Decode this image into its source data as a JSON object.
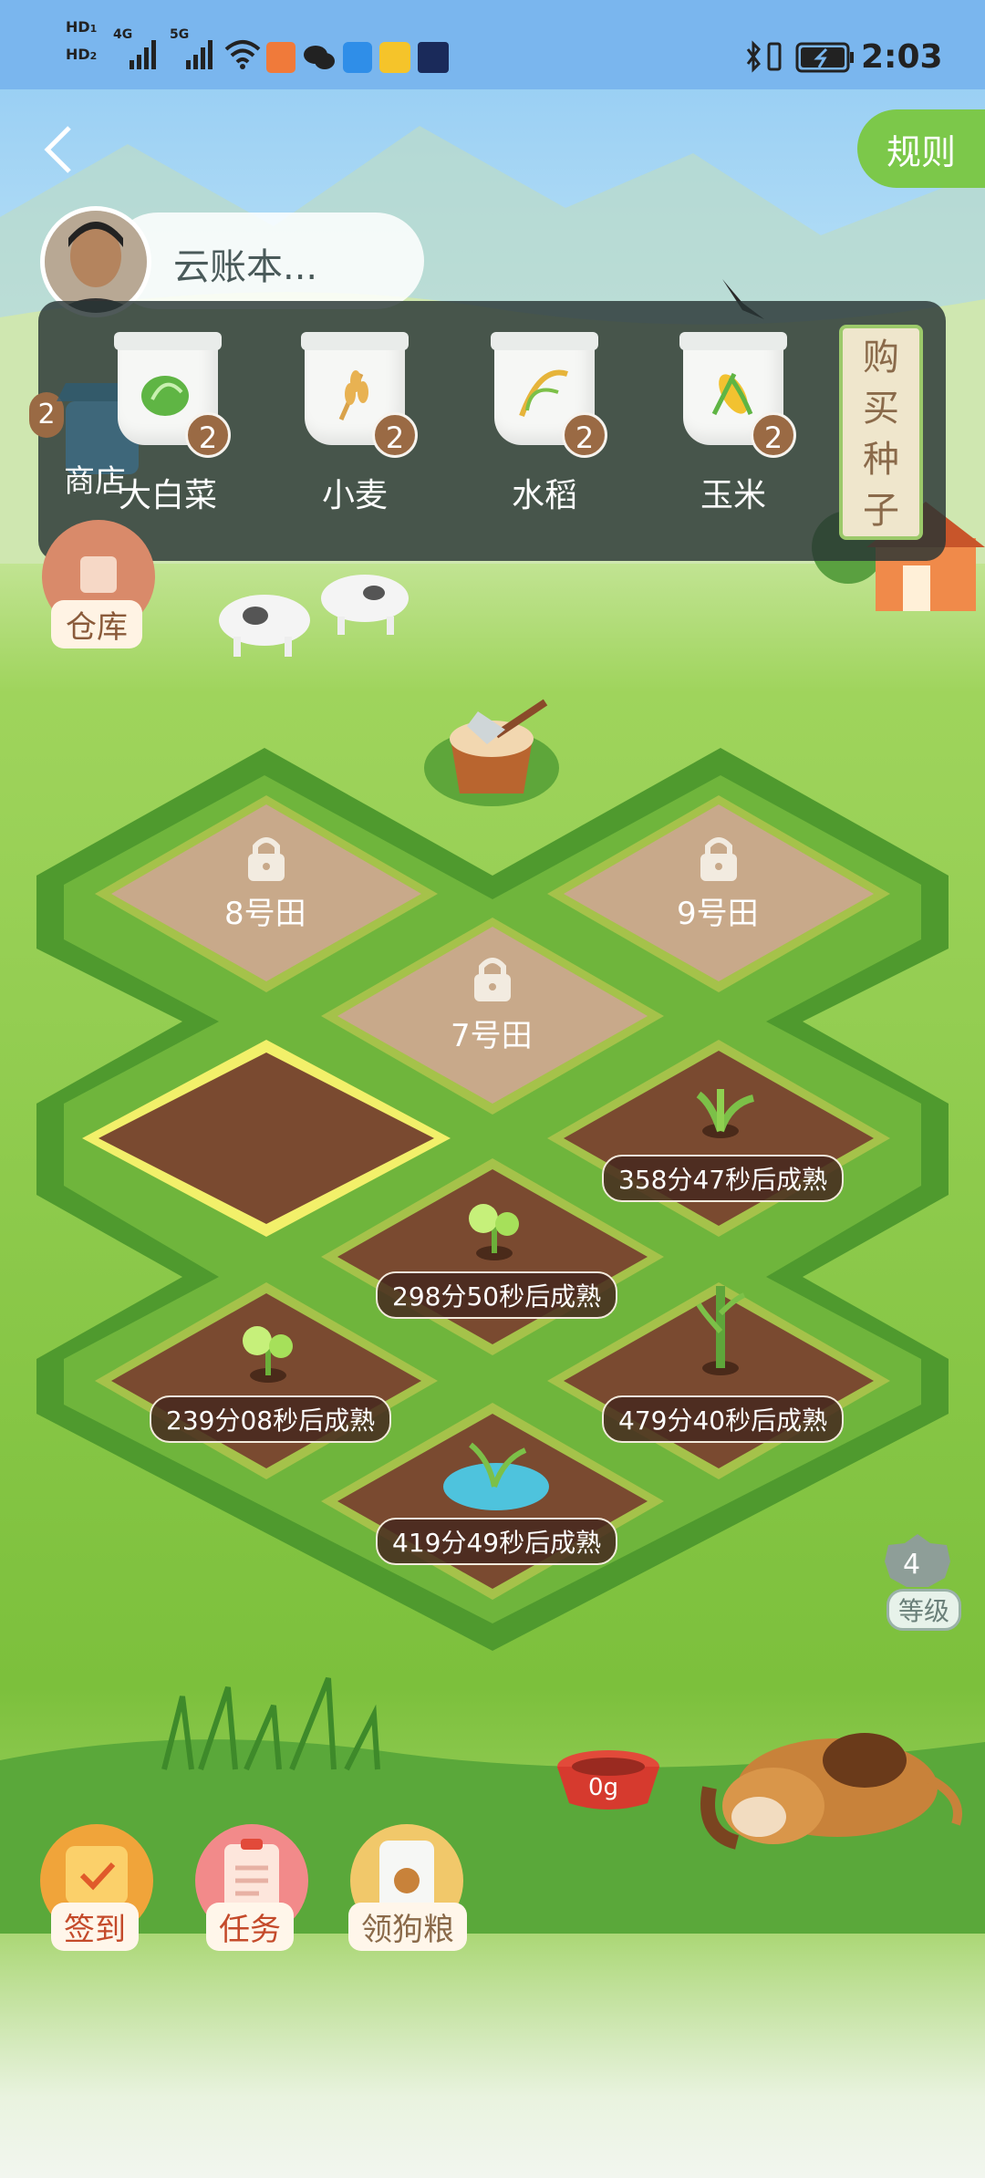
{
  "status_bar": {
    "hd1": "HD",
    "hd1_sub": "1",
    "hd2": "HD",
    "hd2_sub": "2",
    "net1": "4G",
    "net2": "5G",
    "time": "2:03"
  },
  "header": {
    "rules_label": "规则"
  },
  "account": {
    "name": "云账本..."
  },
  "seed_panel": {
    "items": [
      {
        "name": "大白菜",
        "count": "2"
      },
      {
        "name": "小麦",
        "count": "2"
      },
      {
        "name": "水稻",
        "count": "2"
      },
      {
        "name": "玉米",
        "count": "2"
      }
    ],
    "partial_count": "2",
    "buy_label": [
      "购",
      "买",
      "种",
      "子"
    ]
  },
  "side": {
    "shop_label": "商店",
    "warehouse_label": "仓库"
  },
  "fields": {
    "locked": [
      {
        "label": "8号田"
      },
      {
        "label": "9号田"
      },
      {
        "label": "7号田"
      }
    ],
    "timers": [
      "358分47秒后成熟",
      "298分50秒后成熟",
      "239分08秒后成熟",
      "479分40秒后成熟",
      "419分49秒后成熟"
    ]
  },
  "level": {
    "value": "4",
    "label": "等级"
  },
  "dog_bowl": {
    "amount": "0g"
  },
  "bottom_actions": [
    {
      "label": "签到"
    },
    {
      "label": "任务"
    },
    {
      "label": "领狗粮"
    }
  ],
  "colors": {
    "accent_green": "#7cc84a",
    "soil_brown": "#7a4a30",
    "locked_soil": "#c8a98a"
  }
}
